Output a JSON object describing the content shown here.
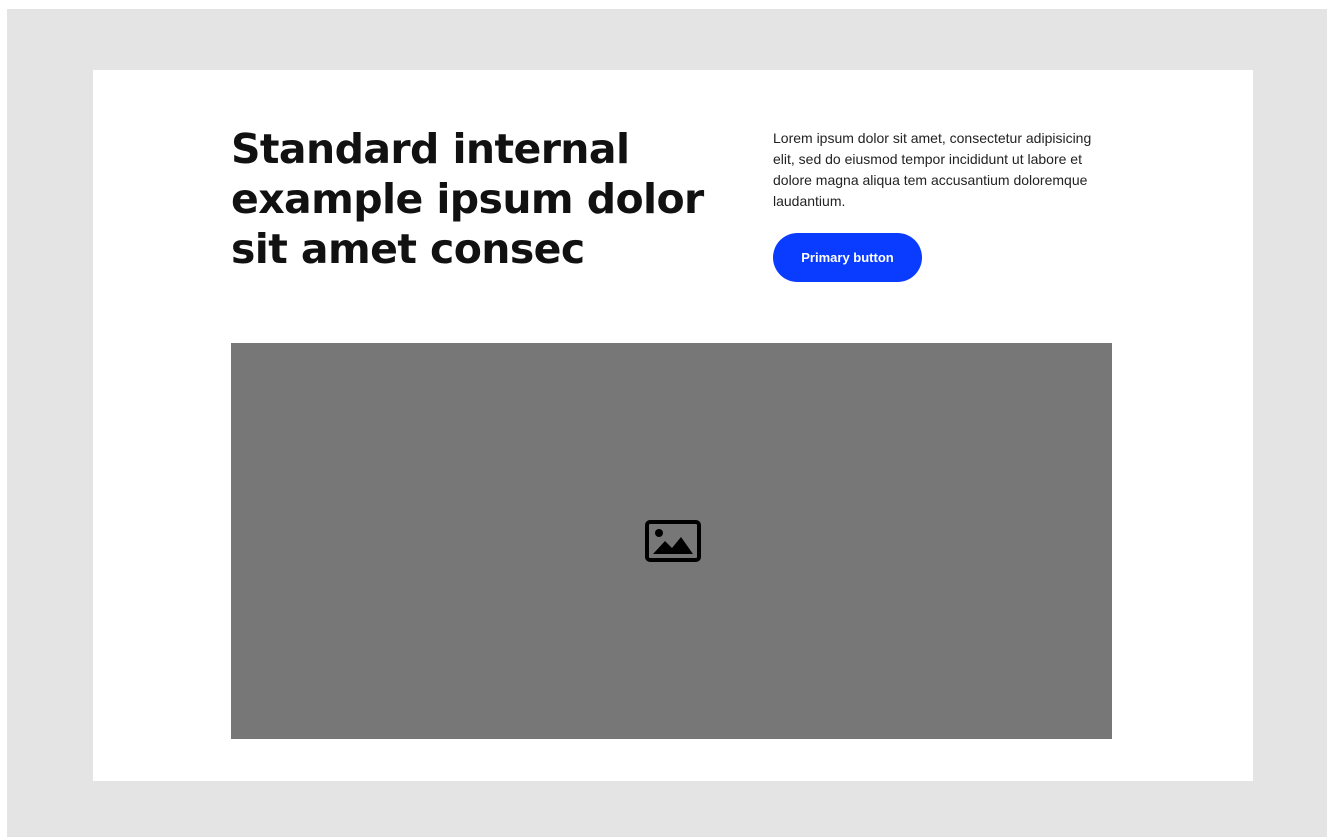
{
  "hero": {
    "title": "Standard internal example ipsum dolor sit amet consec",
    "description": "Lorem ipsum dolor sit amet, consectetur adipisicing elit, sed do eiusmod tempor incididunt ut labore et dolore magna aliqua tem accusantium doloremque laudantium.",
    "primary_button_label": "Primary button"
  },
  "media": {
    "icon": "image-icon"
  },
  "colors": {
    "page_background": "#e4e4e4",
    "card_background": "#ffffff",
    "accent": "#0a3cff",
    "media_placeholder": "#777777",
    "text": "#111111"
  }
}
